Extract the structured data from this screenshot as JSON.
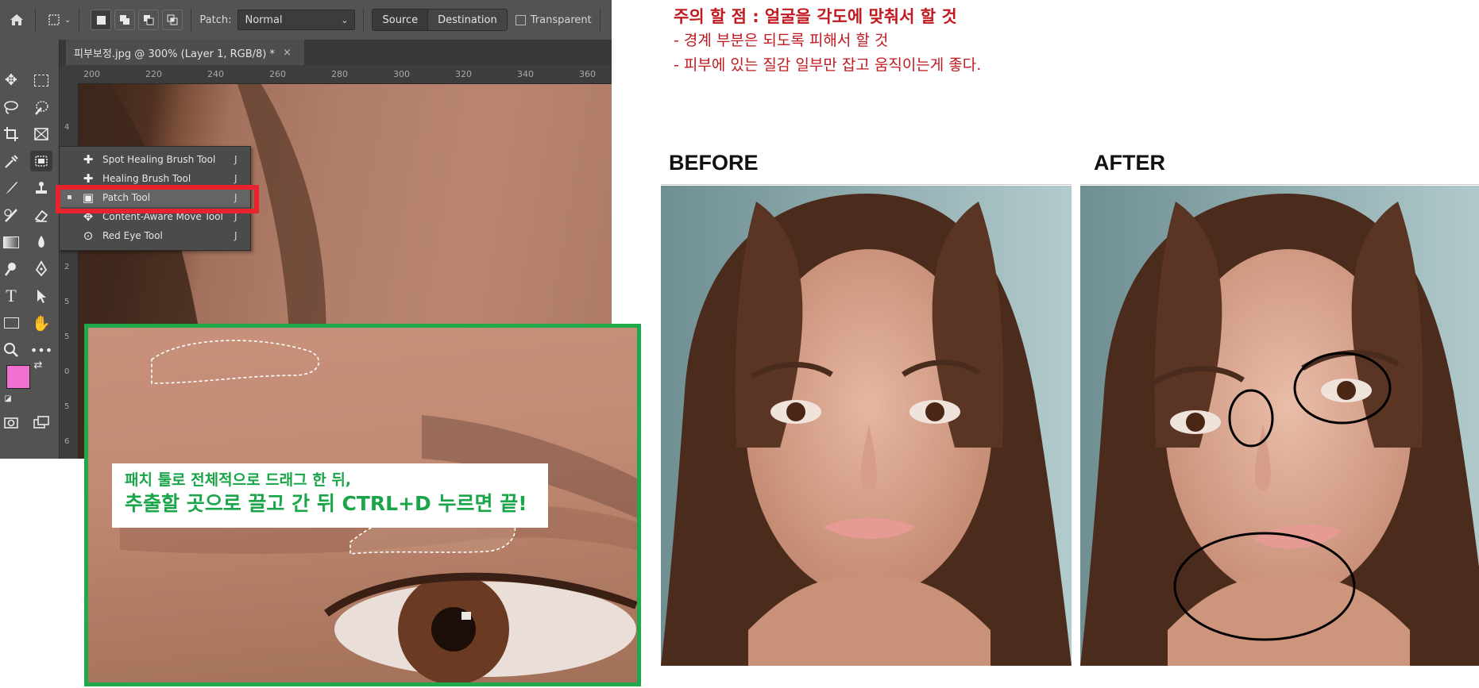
{
  "photoshop": {
    "options_bar": {
      "patch_label": "Patch:",
      "patch_value": "Normal",
      "source_label": "Source",
      "destination_label": "Destination",
      "transparent_label": "Transparent"
    },
    "doc_tab": "피부보정.jpg @ 300% (Layer 1, RGB/8) *",
    "ruler_top": [
      "200",
      "220",
      "240",
      "260",
      "280",
      "300",
      "320",
      "340",
      "360"
    ],
    "ruler_left": [
      "4",
      "5",
      "2",
      "0",
      "2",
      "5",
      "5",
      "0",
      "5",
      "6"
    ],
    "flyout": [
      {
        "label": "Spot Healing Brush Tool",
        "key": "J",
        "icon": "spot-healing-icon"
      },
      {
        "label": "Healing Brush Tool",
        "key": "J",
        "icon": "healing-brush-icon"
      },
      {
        "label": "Patch Tool",
        "key": "J",
        "icon": "patch-icon",
        "selected": true
      },
      {
        "label": "Content-Aware Move Tool",
        "key": "J",
        "icon": "content-aware-move-icon"
      },
      {
        "label": "Red Eye Tool",
        "key": "J",
        "icon": "red-eye-icon"
      }
    ],
    "colors": {
      "foreground": "#f06fcf",
      "background": "#ffffff"
    }
  },
  "inset_caption": {
    "line1": "패치 툴로 전체적으로 드래그 한 뒤,",
    "line2": "추출할 곳으로 끌고 간 뒤 CTRL+D 누르면 끝!"
  },
  "warning": {
    "title": "주의 할 점 : 얼굴을 각도에 맞춰서 할 것",
    "bullets": [
      "-   경계 부분은 되도록 피해서 할 것",
      "-   피부에 있는 질감 일부만 잡고 움직이는게 좋다."
    ]
  },
  "before_label": "BEFORE",
  "after_label": "AFTER",
  "accent_colors": {
    "warning_red": "#c0191f",
    "caption_green": "#19a548",
    "highlight_red": "#e8232d",
    "inset_border": "#1eaa4a"
  }
}
